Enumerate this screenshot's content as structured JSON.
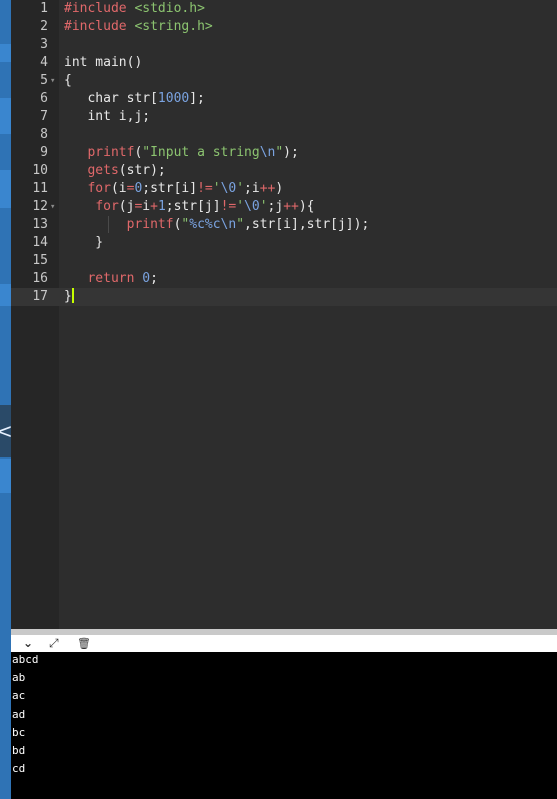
{
  "editor": {
    "lines": [
      {
        "n": "1",
        "fold": "",
        "tokens": [
          [
            "tk-pre",
            "#include "
          ],
          [
            "tk-inc",
            "<stdio.h>"
          ]
        ]
      },
      {
        "n": "2",
        "fold": "",
        "tokens": [
          [
            "tk-pre",
            "#include "
          ],
          [
            "tk-inc",
            "<string.h>"
          ]
        ]
      },
      {
        "n": "3",
        "fold": "",
        "tokens": []
      },
      {
        "n": "4",
        "fold": "",
        "tokens": [
          [
            "",
            "int main()"
          ]
        ]
      },
      {
        "n": "5",
        "fold": "▾",
        "tokens": [
          [
            "",
            "{"
          ]
        ]
      },
      {
        "n": "6",
        "fold": "",
        "tokens": [
          [
            "",
            "   char str["
          ],
          [
            "tk-num",
            "1000"
          ],
          [
            "",
            "];"
          ]
        ]
      },
      {
        "n": "7",
        "fold": "",
        "tokens": [
          [
            "",
            "   int i,j;"
          ]
        ]
      },
      {
        "n": "8",
        "fold": "",
        "tokens": []
      },
      {
        "n": "9",
        "fold": "",
        "tokens": [
          [
            "",
            "   "
          ],
          [
            "tk-fn",
            "printf"
          ],
          [
            "",
            "("
          ],
          [
            "tk-str",
            "\"Input a string"
          ],
          [
            "tk-esc",
            "\\n"
          ],
          [
            "tk-str",
            "\""
          ],
          [
            "",
            ");"
          ]
        ]
      },
      {
        "n": "10",
        "fold": "",
        "tokens": [
          [
            "",
            "   "
          ],
          [
            "tk-fn",
            "gets"
          ],
          [
            "",
            "(str);"
          ]
        ]
      },
      {
        "n": "11",
        "fold": "",
        "tokens": [
          [
            "",
            "   "
          ],
          [
            "tk-fn",
            "for"
          ],
          [
            "",
            "(i"
          ],
          [
            "tk-op",
            "="
          ],
          [
            "tk-num",
            "0"
          ],
          [
            "",
            ";str[i]"
          ],
          [
            "tk-op",
            "!="
          ],
          [
            "tk-str",
            "'"
          ],
          [
            "tk-esc",
            "\\0"
          ],
          [
            "tk-str",
            "'"
          ],
          [
            "",
            ";i"
          ],
          [
            "tk-op",
            "++"
          ],
          [
            "",
            ")"
          ]
        ]
      },
      {
        "n": "12",
        "fold": "▾",
        "tokens": [
          [
            "",
            "    "
          ],
          [
            "tk-fn",
            "for"
          ],
          [
            "",
            "(j"
          ],
          [
            "tk-op",
            "="
          ],
          [
            "",
            "i"
          ],
          [
            "tk-op",
            "+"
          ],
          [
            "tk-num",
            "1"
          ],
          [
            "",
            ";str[j]"
          ],
          [
            "tk-op",
            "!="
          ],
          [
            "tk-str",
            "'"
          ],
          [
            "tk-esc",
            "\\0"
          ],
          [
            "tk-str",
            "'"
          ],
          [
            "",
            ";j"
          ],
          [
            "tk-op",
            "++"
          ],
          [
            "",
            "){"
          ]
        ]
      },
      {
        "n": "13",
        "fold": "",
        "tokens": [
          [
            "",
            "        "
          ],
          [
            "tk-fn",
            "printf"
          ],
          [
            "",
            "("
          ],
          [
            "tk-str",
            "\""
          ],
          [
            "tk-esc",
            "%c%c\\n"
          ],
          [
            "tk-str",
            "\""
          ],
          [
            "",
            ",str[i],str[j]);"
          ]
        ]
      },
      {
        "n": "14",
        "fold": "",
        "tokens": [
          [
            "",
            "    }"
          ]
        ]
      },
      {
        "n": "15",
        "fold": "",
        "tokens": []
      },
      {
        "n": "16",
        "fold": "",
        "tokens": [
          [
            "",
            "   "
          ],
          [
            "tk-fn",
            "return "
          ],
          [
            "tk-num",
            "0"
          ],
          [
            "",
            ";"
          ]
        ]
      },
      {
        "n": "17",
        "fold": "",
        "tokens": [
          [
            "",
            "}"
          ]
        ]
      }
    ],
    "active_line": "17"
  },
  "sidebar": {
    "collapse_glyph": "<"
  },
  "console": {
    "toolbar": {
      "collapse_glyph": "⌄",
      "expand_glyph": "⤢",
      "clear_glyph": "🗑"
    },
    "output": [
      "abcd",
      "ab",
      "ac",
      "ad",
      "bc",
      "bd",
      "cd"
    ]
  },
  "colors": {
    "accent": "#2f73b5",
    "editor_bg": "#2d2d2d",
    "cursor": "#c6ff00"
  }
}
